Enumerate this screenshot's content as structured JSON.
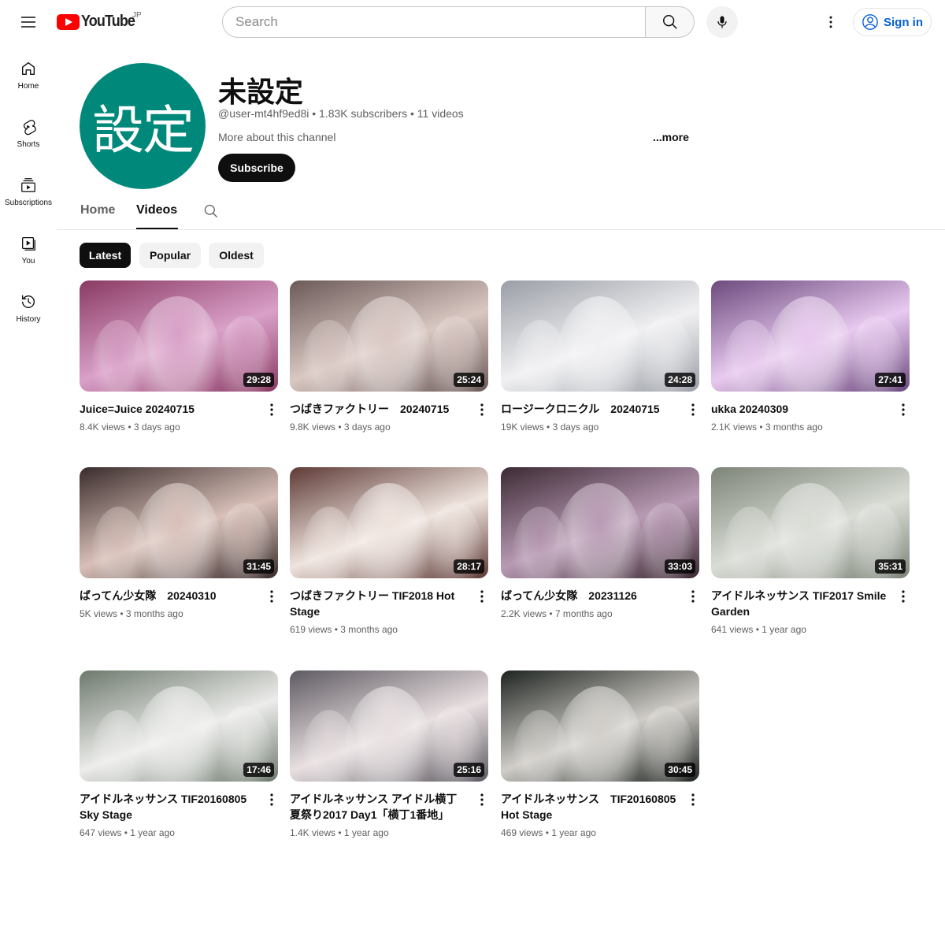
{
  "masthead": {
    "logo_text": "YouTube",
    "country": "JP",
    "search_placeholder": "Search",
    "signin_label": "Sign in"
  },
  "guide": {
    "items": [
      {
        "label": "Home",
        "icon": "home-icon"
      },
      {
        "label": "Shorts",
        "icon": "shorts-icon"
      },
      {
        "label": "Subscriptions",
        "icon": "subscriptions-icon"
      },
      {
        "label": "You",
        "icon": "you-icon"
      },
      {
        "label": "History",
        "icon": "history-icon"
      }
    ]
  },
  "channel": {
    "avatar_text": "設定",
    "avatar_color": "#00897b",
    "name": "未設定",
    "meta": "@user-mt4hf9ed8i • 1.83K subscribers • 11 videos",
    "about": "More about this channel",
    "more": "...more",
    "subscribe_label": "Subscribe"
  },
  "tabs": [
    {
      "label": "Home",
      "active": false
    },
    {
      "label": "Videos",
      "active": true
    }
  ],
  "chips": [
    {
      "label": "Latest",
      "active": true
    },
    {
      "label": "Popular",
      "active": false
    },
    {
      "label": "Oldest",
      "active": false
    }
  ],
  "videos": [
    {
      "title": "Juice=Juice 20240715",
      "views": "8.4K views",
      "age": "3 days ago",
      "duration": "29:28",
      "bg": "#8a3a63",
      "bg2": "#d9a0c8"
    },
    {
      "title": "つばきファクトリー　20240715",
      "views": "9.8K views",
      "age": "3 days ago",
      "duration": "25:24",
      "bg": "#6b5a58",
      "bg2": "#d9c7c2"
    },
    {
      "title": "ロージークロニクル　20240715",
      "views": "19K views",
      "age": "3 days ago",
      "duration": "24:28",
      "bg": "#9a9ea6",
      "bg2": "#f0f0f2"
    },
    {
      "title": "ukka 20240309",
      "views": "2.1K views",
      "age": "3 months ago",
      "duration": "27:41",
      "bg": "#6c4a7e",
      "bg2": "#e8c9ef"
    },
    {
      "title": "ばってん少女隊　20240310",
      "views": "5K views",
      "age": "3 months ago",
      "duration": "31:45",
      "bg": "#3a2c2c",
      "bg2": "#d8c0b8"
    },
    {
      "title": "つばきファクトリー TIF2018 Hot Stage",
      "views": "619 views",
      "age": "3 months ago",
      "duration": "28:17",
      "bg": "#5e3a36",
      "bg2": "#efe4de"
    },
    {
      "title": "ばってん少女隊　20231126",
      "views": "2.2K views",
      "age": "7 months ago",
      "duration": "33:03",
      "bg": "#3c2a34",
      "bg2": "#b89ab4"
    },
    {
      "title": "アイドルネッサンス TIF2017 Smile Garden",
      "views": "641 views",
      "age": "1 year ago",
      "duration": "35:31",
      "bg": "#7d8478",
      "bg2": "#d9ddd6"
    },
    {
      "title": "アイドルネッサンス TIF20160805 Sky Stage",
      "views": "647 views",
      "age": "1 year ago",
      "duration": "17:46",
      "bg": "#6e7a6e",
      "bg2": "#ececea"
    },
    {
      "title": "アイドルネッサンス アイドル横丁夏祭り2017 Day1「横丁1番地」",
      "views": "1.4K views",
      "age": "1 year ago",
      "duration": "25:16",
      "bg": "#5e5a62",
      "bg2": "#e8dfe0"
    },
    {
      "title": "アイドルネッサンス　TIF20160805 Hot Stage",
      "views": "469 views",
      "age": "1 year ago",
      "duration": "30:45",
      "bg": "#1f2420",
      "bg2": "#d0cdc8"
    }
  ]
}
